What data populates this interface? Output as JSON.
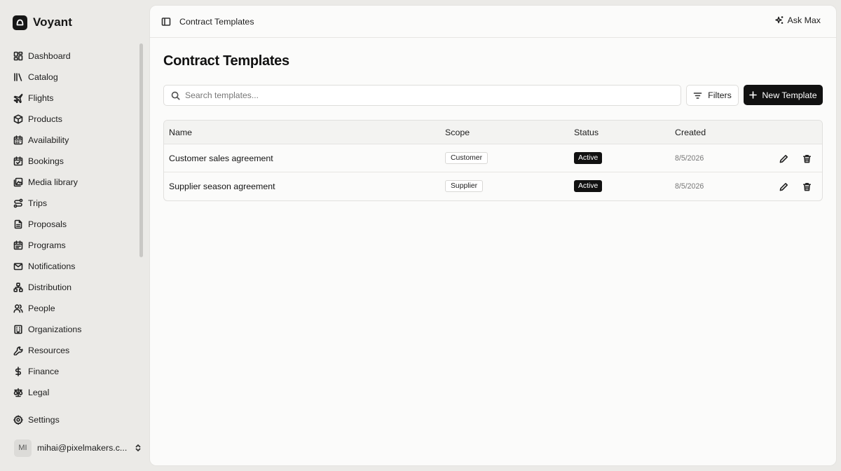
{
  "brand": {
    "name": "Voyant",
    "logo_icon": "voyant-logo-icon"
  },
  "sidebar": {
    "items": [
      {
        "label": "Dashboard",
        "icon": "dashboard-icon"
      },
      {
        "label": "Catalog",
        "icon": "library-icon"
      },
      {
        "label": "Flights",
        "icon": "plane-icon"
      },
      {
        "label": "Products",
        "icon": "package-icon"
      },
      {
        "label": "Availability",
        "icon": "calendar-icon"
      },
      {
        "label": "Bookings",
        "icon": "calendar-check-icon"
      },
      {
        "label": "Media library",
        "icon": "images-icon"
      },
      {
        "label": "Trips",
        "icon": "route-icon"
      },
      {
        "label": "Proposals",
        "icon": "file-text-icon"
      },
      {
        "label": "Programs",
        "icon": "calendar-range-icon"
      },
      {
        "label": "Notifications",
        "icon": "mail-icon"
      },
      {
        "label": "Distribution",
        "icon": "network-icon"
      },
      {
        "label": "People",
        "icon": "users-icon"
      },
      {
        "label": "Organizations",
        "icon": "building-icon"
      },
      {
        "label": "Resources",
        "icon": "wrench-icon"
      },
      {
        "label": "Finance",
        "icon": "dollar-icon"
      },
      {
        "label": "Legal",
        "icon": "scale-icon"
      }
    ],
    "settings_label": "Settings"
  },
  "user": {
    "initials": "MI",
    "email": "mihai@pixelmakers.c..."
  },
  "topbar": {
    "breadcrumb": "Contract Templates",
    "ask_label": "Ask Max"
  },
  "page": {
    "title": "Contract Templates",
    "search_placeholder": "Search templates...",
    "filters_label": "Filters",
    "new_label": "New Template"
  },
  "table": {
    "columns": [
      "Name",
      "Scope",
      "Status",
      "Created"
    ],
    "rows": [
      {
        "name": "Customer sales agreement",
        "scope": "Customer",
        "status": "Active",
        "created": "8/5/2026"
      },
      {
        "name": "Supplier season agreement",
        "scope": "Supplier",
        "status": "Active",
        "created": "8/5/2026"
      }
    ]
  },
  "colors": {
    "accent": "#111111",
    "background": "#ebeae7",
    "panel": "#fbfbfa"
  }
}
